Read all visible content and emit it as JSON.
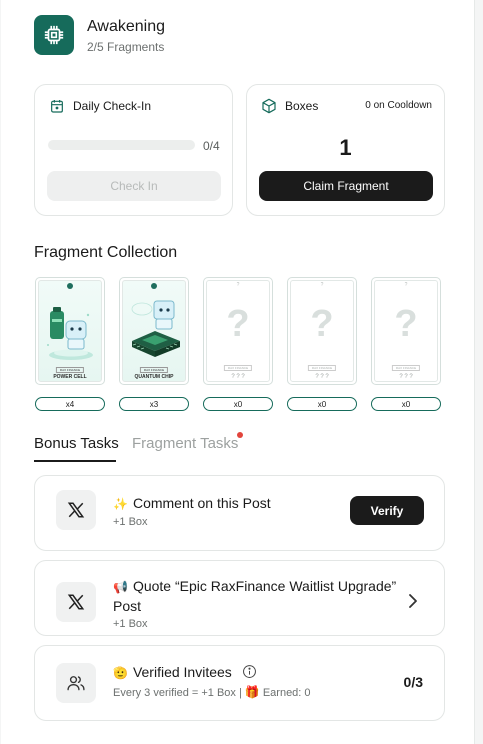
{
  "header": {
    "title": "Awakening",
    "subtitle": "2/5 Fragments",
    "accent_color": "#166b5b",
    "logo_icon": "chip-icon"
  },
  "checkin": {
    "label": "Daily Check-In",
    "icon": "calendar-icon",
    "progress_text": "0/4",
    "progress_fraction": 0,
    "button_label": "Check In"
  },
  "boxes": {
    "label": "Boxes",
    "icon": "box-icon",
    "cooldown": "0 on Cooldown",
    "count": "1",
    "button_label": "Claim Fragment"
  },
  "collection": {
    "title": "Fragment Collection",
    "items": [
      {
        "name": "POWER CELL",
        "brand": "RAX FINANCE",
        "count": "x4",
        "owned": true
      },
      {
        "name": "QUANTUM CHIP",
        "brand": "RAX FINANCE",
        "count": "x3",
        "owned": true
      },
      {
        "name": "? ? ?",
        "mark": "?",
        "brand": "RAX FINANCE",
        "count": "x0",
        "owned": false
      },
      {
        "name": "? ? ?",
        "mark": "?",
        "brand": "RAX FINANCE",
        "count": "x0",
        "owned": false
      },
      {
        "name": "? ? ?",
        "mark": "?",
        "brand": "RAX FINANCE",
        "count": "x0",
        "owned": false
      }
    ]
  },
  "tabs": [
    {
      "label": "Bonus Tasks",
      "active": true
    },
    {
      "label": "Fragment Tasks",
      "active": false,
      "notification_dot": true
    }
  ],
  "tasks": [
    {
      "icon": "x-logo-icon",
      "emoji": "✨",
      "title": "Comment on this Post",
      "reward": "+1 Box",
      "action": "Verify"
    },
    {
      "icon": "x-logo-icon",
      "emoji": "📢",
      "title_line1": "Quote “Epic RaxFinance Waitlist Upgrade”",
      "title_line2": "Post",
      "reward": "+1 Box",
      "action_icon": "chevron-right-icon"
    },
    {
      "icon": "users-icon",
      "emoji": "🫡",
      "title": "Verified Invitees",
      "info_icon": "info-icon",
      "detail_prefix": "Every 3 verified = +1 Box |",
      "detail_emoji": "🎁",
      "detail_suffix": "Earned: 0",
      "ratio": "0/3"
    }
  ]
}
